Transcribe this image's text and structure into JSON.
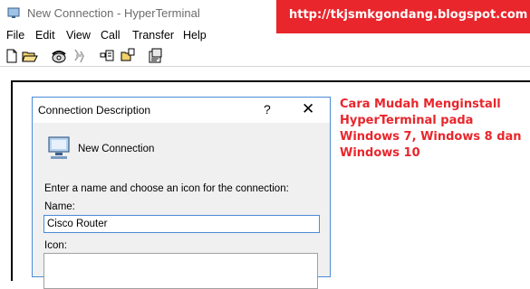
{
  "window": {
    "title": "New Connection - HyperTerminal",
    "icon": "hyperterminal-app-icon"
  },
  "banner": {
    "text": "http://tkjsmkgondang.blogspot.com",
    "color": "#e8262c"
  },
  "menu": {
    "items": [
      "File",
      "Edit",
      "View",
      "Call",
      "Transfer",
      "Help"
    ]
  },
  "toolbar": {
    "icons": [
      "new-document-icon",
      "open-folder-icon",
      "dial-phone-icon",
      "disconnect-icon",
      "send-file-icon",
      "receive-file-icon",
      "properties-icon"
    ]
  },
  "dialog": {
    "title": "Connection Description",
    "help_label": "?",
    "close_label": "✕",
    "connection_name": "New Connection",
    "instruction": "Enter a name and choose an icon for the connection:",
    "name_label": "Name:",
    "name_value": "Cisco Router",
    "icon_label": "Icon:"
  },
  "caption": {
    "text": "Cara Mudah Menginstall HyperTerminal pada Windows 7, Windows 8 dan Windows 10",
    "color": "#e8262c"
  }
}
